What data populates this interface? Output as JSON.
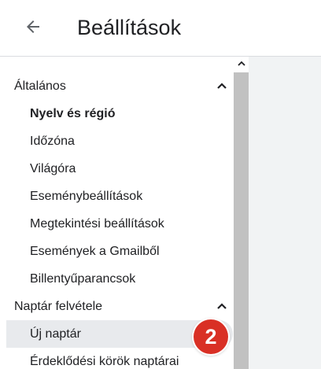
{
  "header": {
    "back_icon": "arrow-back-icon",
    "title": "Beállítások"
  },
  "sidebar": {
    "sections": [
      {
        "label": "Általános",
        "expanded": true,
        "items": [
          {
            "label": "Nyelv és régió",
            "bold": true
          },
          {
            "label": "Időzóna"
          },
          {
            "label": "Világóra"
          },
          {
            "label": "Eseménybeállítások"
          },
          {
            "label": "Megtekintési beállítások"
          },
          {
            "label": "Események a Gmailből"
          },
          {
            "label": "Billentyűparancsok"
          }
        ]
      },
      {
        "label": "Naptár felvétele",
        "expanded": true,
        "items": [
          {
            "label": "Új naptár",
            "selected": true
          },
          {
            "label": "Érdeklődési körök naptárai"
          }
        ]
      }
    ]
  },
  "badge": {
    "text": "2",
    "color": "#d93025"
  },
  "colors": {
    "text": "#202124",
    "selected_bg": "#e8eaed",
    "scroll_thumb": "#c1c1c1",
    "right_panel": "#f1f3f4"
  }
}
